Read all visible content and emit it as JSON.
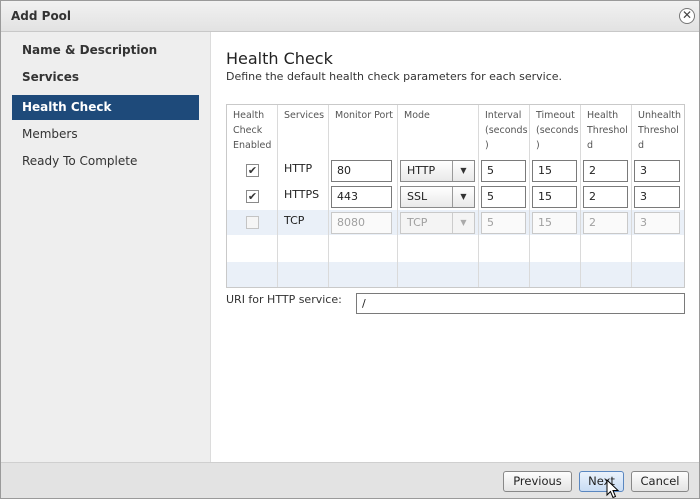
{
  "dialog": {
    "title": "Add Pool",
    "close_glyph": "✕"
  },
  "sidebar": {
    "items": [
      {
        "label": "Name & Description",
        "state": "completed"
      },
      {
        "label": "Services",
        "state": "completed"
      },
      {
        "label": "Health Check",
        "state": "active"
      },
      {
        "label": "Members",
        "state": "pending"
      },
      {
        "label": "Ready To Complete",
        "state": "pending"
      }
    ]
  },
  "main": {
    "title": "Health Check",
    "subtitle": "Define the default health check parameters for each service.",
    "columns": [
      "Health\nCheck\nEnabled",
      "Services",
      "Monitor Port",
      "Mode",
      "Interval\n(seconds\n)",
      "Timeout\n(seconds\n)",
      "Health\nThreshol\nd",
      "Unhealth\nThreshol\nd"
    ],
    "rows": [
      {
        "enabled": true,
        "service": "HTTP",
        "port": "80",
        "mode": "HTTP",
        "interval": "5",
        "timeout": "15",
        "health": "2",
        "unhealth": "3",
        "disabled": false
      },
      {
        "enabled": true,
        "service": "HTTPS",
        "port": "443",
        "mode": "SSL",
        "interval": "5",
        "timeout": "15",
        "health": "2",
        "unhealth": "3",
        "disabled": false
      },
      {
        "enabled": false,
        "service": "TCP",
        "port": "8080",
        "mode": "TCP",
        "interval": "5",
        "timeout": "15",
        "health": "2",
        "unhealth": "3",
        "disabled": true
      }
    ],
    "check_glyph": "✔",
    "dropdown_glyph": "▼",
    "uri_label": "URI for HTTP service:",
    "uri_value": "/"
  },
  "footer": {
    "previous_label": "Previous",
    "next_label": "Next",
    "cancel_label": "Cancel"
  },
  "colors": {
    "active_nav": "#1e4a7a",
    "row_alt": "#eaf0f8"
  }
}
